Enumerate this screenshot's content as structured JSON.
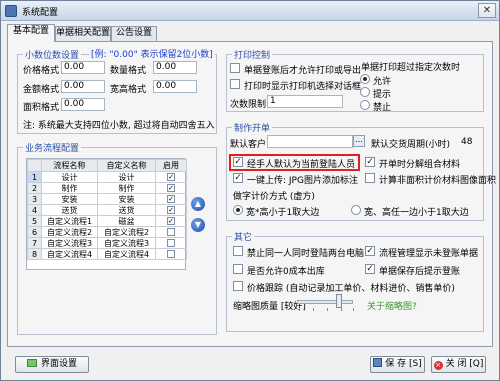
{
  "window": {
    "title": "系统配置",
    "close_glyph": "✕"
  },
  "tabs": [
    "基本配置",
    "单据相关配置",
    "公告设置"
  ],
  "decimal": {
    "title": "小数位数设置",
    "hint": "[例: \"0.00\" 表示保留2位小数]",
    "price_label": "价格格式",
    "price_value": "0.00",
    "qty_label": "数量格式",
    "qty_value": "0.00",
    "amount_label": "金额格式",
    "amount_value": "0.00",
    "width_label": "宽高格式",
    "width_value": "0.00",
    "area_label": "面积格式",
    "area_value": "0.00",
    "note": "注: 系统最大支持四位小数, 超过将自动四舍五入"
  },
  "workflow": {
    "title": "业务流程配置",
    "headers": [
      "流程名称",
      "自定义名称",
      "启用"
    ],
    "rows": [
      {
        "no": "1",
        "name": "设计",
        "custom": "设计",
        "enabled": true
      },
      {
        "no": "2",
        "name": "制作",
        "custom": "制作",
        "enabled": true
      },
      {
        "no": "3",
        "name": "安装",
        "custom": "安装",
        "enabled": true
      },
      {
        "no": "4",
        "name": "送货",
        "custom": "送货",
        "enabled": true
      },
      {
        "no": "5",
        "name": "自定义流程1",
        "custom": "磁盆",
        "enabled": true
      },
      {
        "no": "6",
        "name": "自定义流程2",
        "custom": "自定义流程2",
        "enabled": false
      },
      {
        "no": "7",
        "name": "自定义流程3",
        "custom": "自定义流程3",
        "enabled": false
      },
      {
        "no": "8",
        "name": "自定义流程4",
        "custom": "自定义流程4",
        "enabled": false
      }
    ],
    "up_glyph": "▲",
    "down_glyph": "▼"
  },
  "print": {
    "title": "打印控制",
    "opt1": "单据登账后才允许打印或导出",
    "opt2": "打印时显示打印机选择对话框",
    "limit_label": "次数限制",
    "limit_value": "1",
    "exceed_title": "单据打印超过指定次数时",
    "exceed_opts": [
      "允许",
      "提示",
      "禁止"
    ],
    "exceed_selected": 0
  },
  "order": {
    "title": "制作开单",
    "default_customer_label": "默认客户",
    "default_customer_value": "",
    "dots": "...",
    "cycle_label": "默认交货周期(小时)",
    "cycle_value": "48",
    "handler_default": "经手人默认为当前登陆人员",
    "open_merge": "开单时分解组合材料",
    "upload_label": "一键上传: JPG图片添加标注",
    "calc_area": "计算非面积计价材料图像面积",
    "calc_method_label": "做字计价方式 (虚方)",
    "calc_opt1": "宽*高小于1取大边",
    "calc_opt2": "宽、高任一边小于1取大边",
    "calc_selected": 0
  },
  "other": {
    "title": "其它",
    "opt1": "禁止同一人同时登陆两台电脑",
    "opt2": "流程管理显示未登账单据",
    "opt3": "是否允许0成本出库",
    "opt4": "单据保存后提示登账",
    "opt5": "价格跟踪 (自动记录加工单价、材料进价、销售单价)",
    "thumb_label": "缩略图质量 [较好]",
    "thumb_link": "关于缩略图?",
    "thumb_quality": 0.75
  },
  "footer": {
    "ui_settings": "界面设置",
    "save": "保 存 [S]",
    "close": "关 闭 [Q]"
  },
  "colors": {
    "accent": "#2a4fa8",
    "highlight": "#e02020",
    "link": "#3a9a2f"
  }
}
